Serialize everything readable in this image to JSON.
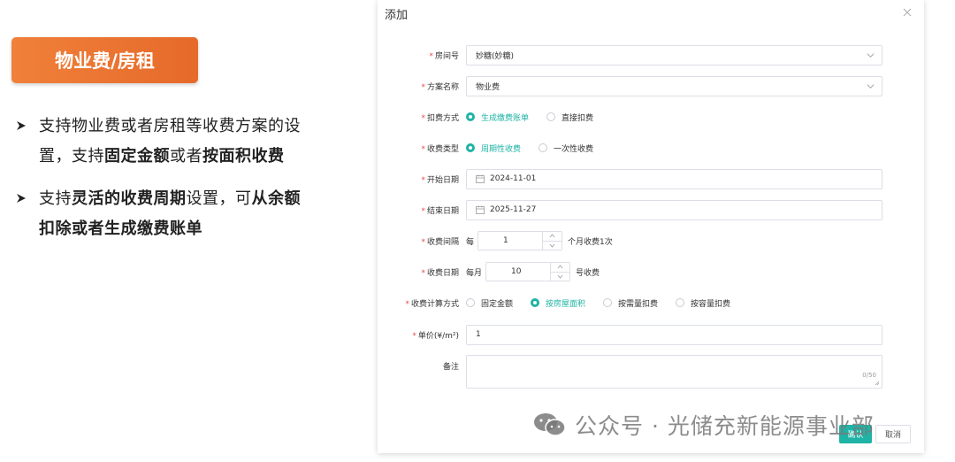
{
  "slide": {
    "badge": "物业费/房租",
    "bullets": [
      {
        "parts": [
          {
            "t": "支持物业费或者房租等收费方案的设置，支持",
            "b": false
          },
          {
            "t": "固定金额",
            "b": true
          },
          {
            "t": "或者",
            "b": false
          },
          {
            "t": "按面积收费",
            "b": true
          }
        ]
      },
      {
        "parts": [
          {
            "t": "支持",
            "b": false
          },
          {
            "t": "灵活的收费周期",
            "b": true
          },
          {
            "t": "设置，可",
            "b": false
          },
          {
            "t": "从余额扣除或者生成缴费账单",
            "b": true
          }
        ]
      }
    ]
  },
  "dialog": {
    "title": "添加",
    "room": {
      "label": "房间号",
      "value": "妙糖(妙糖)"
    },
    "plan": {
      "label": "方案名称",
      "value": "物业费"
    },
    "deduct": {
      "label": "扣费方式",
      "options": [
        "生成缴费账单",
        "直接扣费"
      ],
      "selected": 0
    },
    "charge_type": {
      "label": "收费类型",
      "options": [
        "周期性收费",
        "一次性收费"
      ],
      "selected": 0
    },
    "start_date": {
      "label": "开始日期",
      "value": "2024-11-01"
    },
    "end_date": {
      "label": "结束日期",
      "value": "2025-11-27"
    },
    "interval": {
      "label": "收费间隔",
      "prefix": "每",
      "value": "1",
      "suffix": "个月收费1次"
    },
    "charge_day": {
      "label": "收费日期",
      "prefix": "每月",
      "value": "10",
      "suffix": "号收费"
    },
    "calc_method": {
      "label": "收费计算方式",
      "options": [
        "固定金额",
        "按房屋面积",
        "按需量扣费",
        "按容量扣费"
      ],
      "selected": 1
    },
    "unit_price": {
      "label": "单价(¥/m²)",
      "value": "1"
    },
    "remark": {
      "label": "备注",
      "counter": "0/50"
    },
    "ok": "确认",
    "cancel": "取消"
  },
  "watermark": "公众号 · 光储充新能源事业部",
  "colors": {
    "accent": "#1fb3a6",
    "badge": "#ea7430",
    "required": "#e94b4b"
  }
}
